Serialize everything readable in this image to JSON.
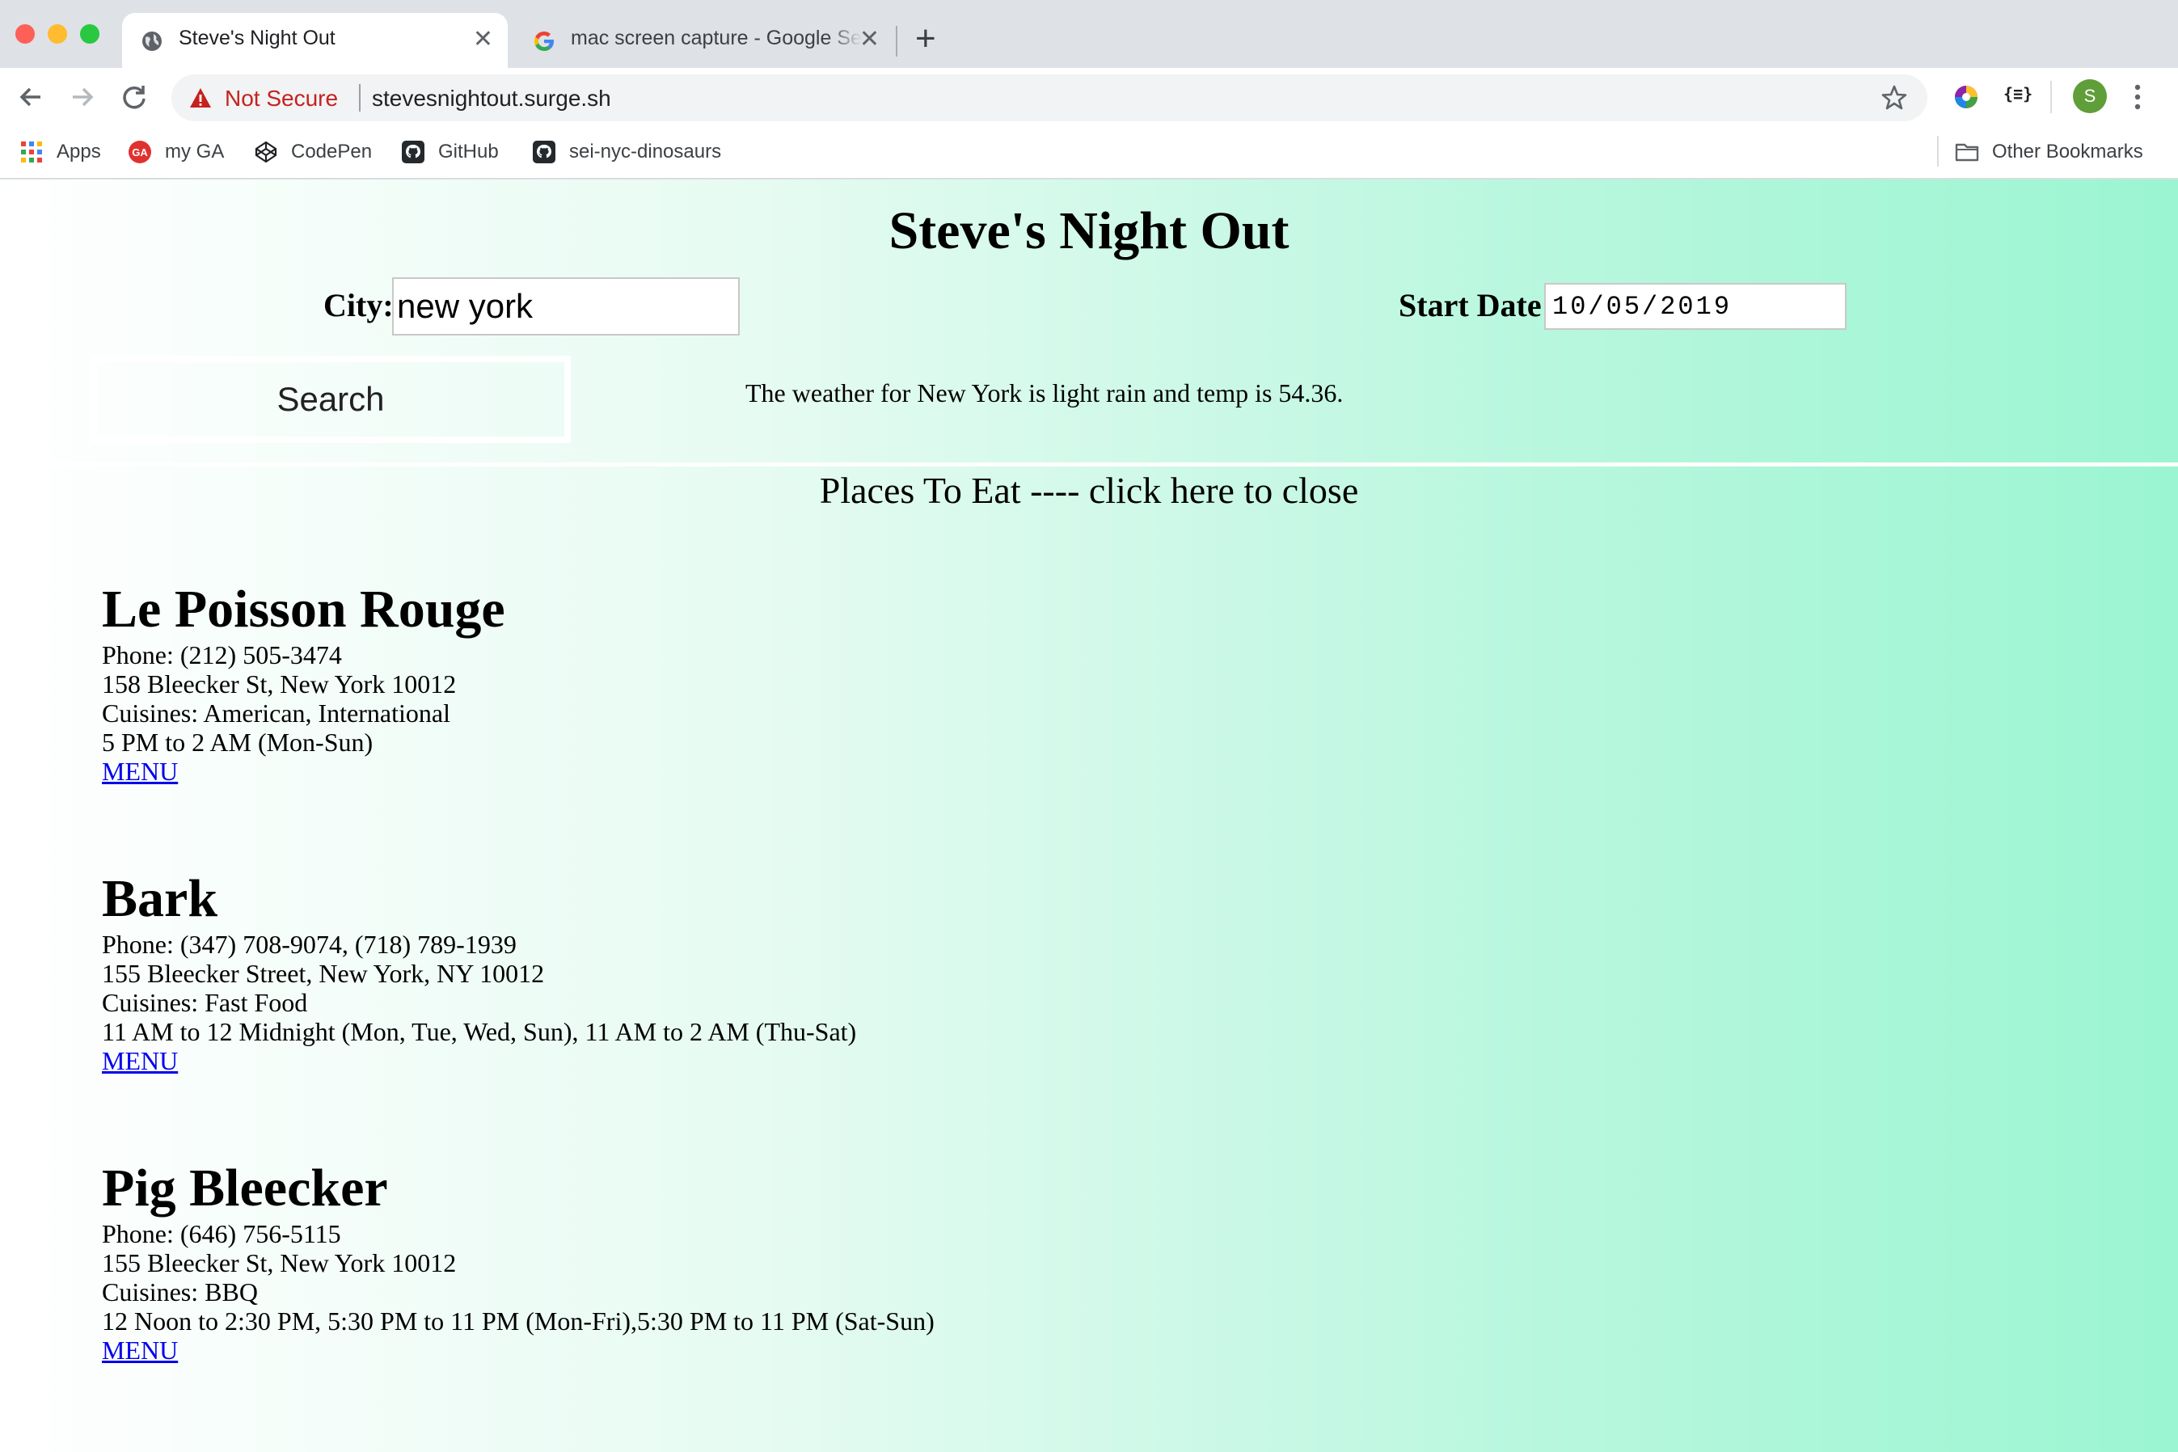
{
  "browser": {
    "tabs": [
      {
        "title": "Steve's Night Out",
        "active": true,
        "favicon": "globe-icon"
      },
      {
        "title": "mac screen capture - Google Search",
        "active": false,
        "favicon": "google-icon"
      }
    ],
    "address_bar": {
      "security": "Not Secure",
      "url": "stevesnightout.surge.sh"
    },
    "bookmarks": [
      {
        "label": "Apps",
        "icon": "apps-grid-icon"
      },
      {
        "label": "my GA",
        "icon": "ga-icon"
      },
      {
        "label": "CodePen",
        "icon": "codepen-icon"
      },
      {
        "label": "GitHub",
        "icon": "github-icon"
      },
      {
        "label": "sei-nyc-dinosaurs",
        "icon": "github-icon"
      }
    ],
    "other_bookmarks": "Other Bookmarks",
    "profile_initial": "S",
    "json_ext_label": "{≡}"
  },
  "page": {
    "title": "Steve's Night Out",
    "city_label": "City:",
    "city_value": "new york",
    "start_date_label": "Start Date:",
    "start_date_value": "10/05/2019",
    "search_label": "Search",
    "weather": "The weather for New York is light rain and temp is 54.36.",
    "places_toggle": "Places To Eat ---- click here to close"
  },
  "restaurants": [
    {
      "name": "Le Poisson Rouge",
      "phone": "Phone: (212) 505-3474",
      "address": "158 Bleecker St, New York 10012",
      "cuisines": "Cuisines: American, International",
      "hours": "5 PM to 2 AM (Mon-Sun)",
      "menu": "MENU"
    },
    {
      "name": "Bark",
      "phone": "Phone: (347) 708-9074, (718) 789-1939",
      "address": "155 Bleecker Street, New York, NY 10012",
      "cuisines": "Cuisines: Fast Food",
      "hours": "11 AM to 12 Midnight (Mon, Tue, Wed, Sun), 11 AM to 2 AM (Thu-Sat)",
      "menu": "MENU"
    },
    {
      "name": "Pig Bleecker",
      "phone": "Phone: (646) 756-5115",
      "address": "155 Bleecker St, New York 10012",
      "cuisines": "Cuisines: BBQ",
      "hours": "12 Noon to 2:30 PM, 5:30 PM to 11 PM (Mon-Fri),5:30 PM to 11 PM (Sat-Sun)",
      "menu": "MENU"
    }
  ],
  "colors": {
    "gradient_start": "#ffffff",
    "gradient_end": "#9bf5d2",
    "link": "#0000ee",
    "not_secure": "#c5221f"
  }
}
